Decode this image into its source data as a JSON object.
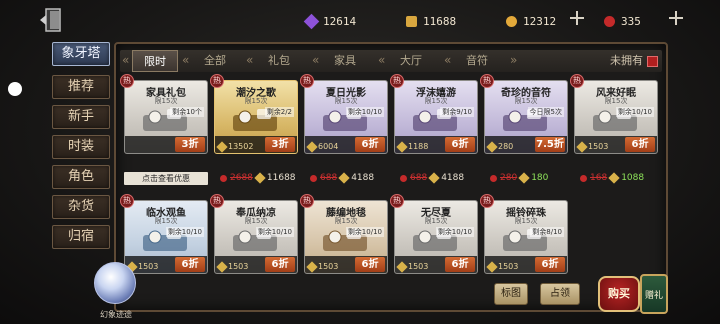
{
  "topbar": {
    "purple_currency": "12614",
    "puzzle_currency": "11688",
    "coin_currency": "12312",
    "red_currency": "335"
  },
  "nav": {
    "items": [
      "象牙塔",
      "推荐",
      "新手",
      "时装",
      "角色",
      "杂货",
      "归宿"
    ],
    "active": "象牙塔"
  },
  "tabs": {
    "items": [
      "限时",
      "全部",
      "礼包",
      "家具",
      "大厅",
      "音符"
    ],
    "active": "限时",
    "not_owned_label": "未拥有"
  },
  "cards": [
    {
      "name": "家具礼包",
      "limit": "限15次",
      "remain": "剩余10个",
      "discount": "3折",
      "price": "",
      "theme": "plain",
      "hot": true
    },
    {
      "name": "潮汐之歌",
      "limit": "限15次",
      "remain": "剩余2/2",
      "discount": "3折",
      "price": "13502",
      "theme": "gold",
      "hot": true
    },
    {
      "name": "夏日光影",
      "limit": "限15次",
      "remain": "剩余10/10",
      "discount": "6折",
      "price": "6004",
      "theme": "purple",
      "hot": true
    },
    {
      "name": "浮沫嬉游",
      "limit": "限15次",
      "remain": "剩余9/10",
      "discount": "6折",
      "price": "1188",
      "theme": "purple",
      "hot": true
    },
    {
      "name": "奇珍的音符",
      "limit": "限15次",
      "remain": "今日限5次",
      "discount": "7.5折",
      "price": "280",
      "theme": "purple",
      "hot": true
    },
    {
      "name": "风来好眠",
      "limit": "限15次",
      "remain": "剩余10/10",
      "discount": "6折",
      "price": "1503",
      "theme": "plain",
      "hot": true
    },
    {
      "name": "临水观鱼",
      "limit": "限15次",
      "remain": "剩余10/10",
      "discount": "6折",
      "price": "1503",
      "theme": "blue",
      "hot": true
    },
    {
      "name": "奉瓜纳凉",
      "limit": "限15次",
      "remain": "剩余10/10",
      "discount": "6折",
      "price": "1503",
      "theme": "plain",
      "hot": true
    },
    {
      "name": "藤编地毯",
      "limit": "限15次",
      "remain": "剩余10/10",
      "discount": "6折",
      "price": "1503",
      "theme": "brown",
      "hot": true
    },
    {
      "name": "无尽夏",
      "limit": "限15次",
      "remain": "剩余10/10",
      "discount": "6折",
      "price": "1503",
      "theme": "plain",
      "hot": true
    },
    {
      "name": "摇铃碎珠",
      "limit": "限15次",
      "remain": "剩余8/10",
      "discount": "6折",
      "price": "1503",
      "theme": "plain",
      "hot": true
    }
  ],
  "prices_row1": [
    {
      "orig": "",
      "now": "点击查看优惠",
      "now_color": "link"
    },
    {
      "orig": "2688",
      "now": "11688",
      "now_color": "white"
    },
    {
      "orig": "688",
      "now": "4188",
      "now_color": "white"
    },
    {
      "orig": "688",
      "now": "4188",
      "now_color": "white"
    },
    {
      "orig": "280",
      "now": "180",
      "now_color": "green"
    },
    {
      "orig": "168",
      "now": "1088",
      "now_color": "green"
    }
  ],
  "bottom": {
    "orb_label": "幻象迹途",
    "btn1_label": "标图",
    "btn2_label": "占领",
    "buy_label": "购买",
    "gift_label": "赠礼"
  },
  "colors": {
    "accent_gold": "#e4c270",
    "discount_orange": "#d36a33",
    "nav_active": "#4a5a78",
    "currency_red": "#c42a2a"
  }
}
